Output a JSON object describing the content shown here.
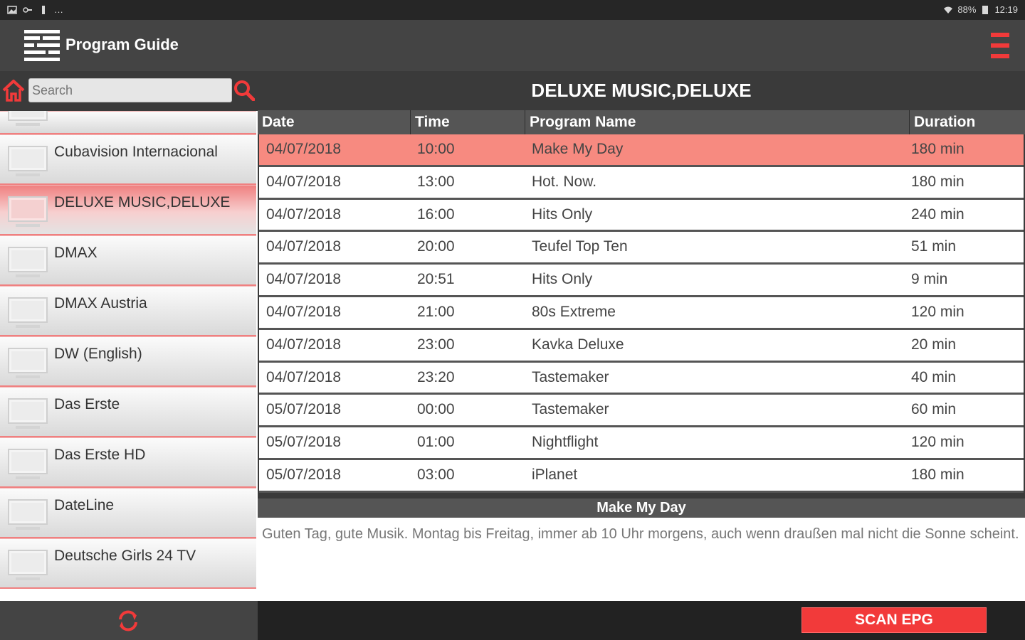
{
  "status_bar": {
    "left_text": "…",
    "battery": "88%",
    "time": "12:19"
  },
  "app": {
    "title": "Program Guide",
    "accent_color": "#f23a3a"
  },
  "search": {
    "placeholder": "Search",
    "value": ""
  },
  "channels": [
    {
      "name": ""
    },
    {
      "name": "Cubavision Internacional"
    },
    {
      "name": "DELUXE MUSIC,DELUXE",
      "selected": true
    },
    {
      "name": "DMAX"
    },
    {
      "name": "DMAX Austria"
    },
    {
      "name": "DW (English)"
    },
    {
      "name": "Das Erste"
    },
    {
      "name": "Das Erste HD"
    },
    {
      "name": "DateLine"
    },
    {
      "name": "Deutsche Girls 24 TV"
    }
  ],
  "guide": {
    "channel_title": "DELUXE MUSIC,DELUXE",
    "columns": [
      "Date",
      "Time",
      "Program Name",
      "Duration"
    ],
    "rows": [
      {
        "date": "04/07/2018",
        "time": "10:00",
        "program": "Make My Day",
        "duration": "180 min",
        "selected": true
      },
      {
        "date": "04/07/2018",
        "time": "13:00",
        "program": "Hot. Now.",
        "duration": "180 min"
      },
      {
        "date": "04/07/2018",
        "time": "16:00",
        "program": "Hits Only",
        "duration": "240 min"
      },
      {
        "date": "04/07/2018",
        "time": "20:00",
        "program": "Teufel Top Ten",
        "duration": "51 min"
      },
      {
        "date": "04/07/2018",
        "time": "20:51",
        "program": "Hits Only",
        "duration": "9 min"
      },
      {
        "date": "04/07/2018",
        "time": "21:00",
        "program": "80s Extreme",
        "duration": "120 min"
      },
      {
        "date": "04/07/2018",
        "time": "23:00",
        "program": "Kavka Deluxe",
        "duration": "20 min"
      },
      {
        "date": "04/07/2018",
        "time": "23:20",
        "program": "Tastemaker",
        "duration": "40 min"
      },
      {
        "date": "05/07/2018",
        "time": "00:00",
        "program": "Tastemaker",
        "duration": "60 min"
      },
      {
        "date": "05/07/2018",
        "time": "01:00",
        "program": "Nightflight",
        "duration": "120 min"
      },
      {
        "date": "05/07/2018",
        "time": "03:00",
        "program": "iPlanet",
        "duration": "180 min"
      }
    ],
    "detail": {
      "title": "Make My Day",
      "description": "Guten Tag, gute Musik. Montag bis Freitag, immer ab 10 Uhr morgens, auch wenn draußen mal nicht die Sonne scheint."
    }
  },
  "actions": {
    "scan_label": "SCAN EPG"
  },
  "icons": {
    "home": "home-icon",
    "search": "search-icon",
    "menu": "menu-icon",
    "refresh": "refresh-icon",
    "tv": "tv-icon",
    "logo": "program-guide-logo-icon"
  }
}
